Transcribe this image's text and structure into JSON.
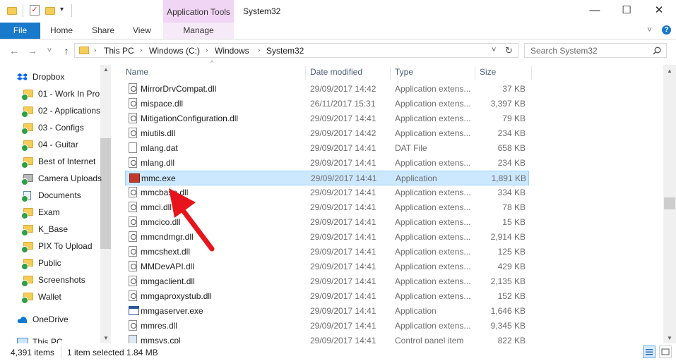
{
  "window": {
    "title": "System32",
    "contextual_tab_group": "Application Tools",
    "controls": {
      "minimize": "—",
      "maximize": "☐",
      "close": "✕"
    }
  },
  "ribbon": {
    "tabs": [
      "File",
      "Home",
      "Share",
      "View"
    ],
    "contextual_tab": "Manage",
    "collapse_icon": "˅",
    "help_icon": "?"
  },
  "address_bar": {
    "back": "←",
    "forward": "→",
    "recent": "˅",
    "up": "↑",
    "crumbs": [
      "This PC",
      "Windows (C:)",
      "Windows",
      "System32"
    ],
    "dropdown": "˅",
    "refresh": "↻"
  },
  "search": {
    "placeholder": "Search System32",
    "icon": "search-icon"
  },
  "nav_pane": {
    "items": [
      {
        "label": "Dropbox",
        "icon": "dropbox-icon"
      },
      {
        "label": "01 - Work In Pro",
        "icon": "folder-icon"
      },
      {
        "label": "02 - Applications",
        "icon": "folder-icon"
      },
      {
        "label": "03 - Configs",
        "icon": "folder-icon"
      },
      {
        "label": "04 - Guitar",
        "icon": "folder-icon"
      },
      {
        "label": "Best of Internet",
        "icon": "folder-icon"
      },
      {
        "label": "Camera Uploads",
        "icon": "camera-folder-icon"
      },
      {
        "label": "Documents",
        "icon": "documents-icon"
      },
      {
        "label": "Exam",
        "icon": "folder-icon"
      },
      {
        "label": "K_Base",
        "icon": "folder-icon"
      },
      {
        "label": "PIX To Upload",
        "icon": "folder-icon"
      },
      {
        "label": "Public",
        "icon": "folder-icon"
      },
      {
        "label": "Screenshots",
        "icon": "folder-icon"
      },
      {
        "label": "Wallet",
        "icon": "folder-icon"
      },
      {
        "label": "OneDrive",
        "icon": "onedrive-icon"
      },
      {
        "label": "This PC",
        "icon": "pc-icon"
      }
    ]
  },
  "columns": {
    "name": "Name",
    "date": "Date modified",
    "type": "Type",
    "size": "Size"
  },
  "files": [
    {
      "name": "MirrorDrvCompat.dll",
      "date": "29/09/2017 14:42",
      "type": "Application extens...",
      "size": "37 KB",
      "icon": "dll"
    },
    {
      "name": "mispace.dll",
      "date": "26/11/2017 15:31",
      "type": "Application extens...",
      "size": "3,397 KB",
      "icon": "dll"
    },
    {
      "name": "MitigationConfiguration.dll",
      "date": "29/09/2017 14:41",
      "type": "Application extens...",
      "size": "79 KB",
      "icon": "dll"
    },
    {
      "name": "miutils.dll",
      "date": "29/09/2017 14:42",
      "type": "Application extens...",
      "size": "234 KB",
      "icon": "dll"
    },
    {
      "name": "mlang.dat",
      "date": "29/09/2017 14:41",
      "type": "DAT File",
      "size": "658 KB",
      "icon": "file"
    },
    {
      "name": "mlang.dll",
      "date": "29/09/2017 14:41",
      "type": "Application extens...",
      "size": "234 KB",
      "icon": "dll"
    },
    {
      "name": "mmc.exe",
      "date": "29/09/2017 14:41",
      "type": "Application",
      "size": "1,891 KB",
      "icon": "mmc",
      "selected": true
    },
    {
      "name": "mmcbase.dll",
      "date": "29/09/2017 14:41",
      "type": "Application extens...",
      "size": "334 KB",
      "icon": "dll"
    },
    {
      "name": "mmci.dll",
      "date": "29/09/2017 14:41",
      "type": "Application extens...",
      "size": "78 KB",
      "icon": "dll"
    },
    {
      "name": "mmcico.dll",
      "date": "29/09/2017 14:41",
      "type": "Application extens...",
      "size": "15 KB",
      "icon": "dll"
    },
    {
      "name": "mmcndmgr.dll",
      "date": "29/09/2017 14:41",
      "type": "Application extens...",
      "size": "2,914 KB",
      "icon": "dll"
    },
    {
      "name": "mmcshext.dll",
      "date": "29/09/2017 14:41",
      "type": "Application extens...",
      "size": "125 KB",
      "icon": "dll"
    },
    {
      "name": "MMDevAPI.dll",
      "date": "29/09/2017 14:41",
      "type": "Application extens...",
      "size": "429 KB",
      "icon": "dll"
    },
    {
      "name": "mmgaclient.dll",
      "date": "29/09/2017 14:41",
      "type": "Application extens...",
      "size": "2,135 KB",
      "icon": "dll"
    },
    {
      "name": "mmgaproxystub.dll",
      "date": "29/09/2017 14:41",
      "type": "Application extens...",
      "size": "152 KB",
      "icon": "dll"
    },
    {
      "name": "mmgaserver.exe",
      "date": "29/09/2017 14:41",
      "type": "Application",
      "size": "1,646 KB",
      "icon": "exe"
    },
    {
      "name": "mmres.dll",
      "date": "29/09/2017 14:41",
      "type": "Application extens...",
      "size": "9,345 KB",
      "icon": "dll"
    },
    {
      "name": "mmsys.cpl",
      "date": "29/09/2017 14:41",
      "type": "Control panel item",
      "size": "822 KB",
      "icon": "cpl"
    }
  ],
  "status": {
    "count": "4,391 items",
    "selected": "1 item selected",
    "size": "1.84 MB"
  },
  "colors": {
    "accent": "#1979ca",
    "selection": "#cce8ff",
    "context_tab": "#f1d5f4",
    "arrow": "#e8141b"
  }
}
